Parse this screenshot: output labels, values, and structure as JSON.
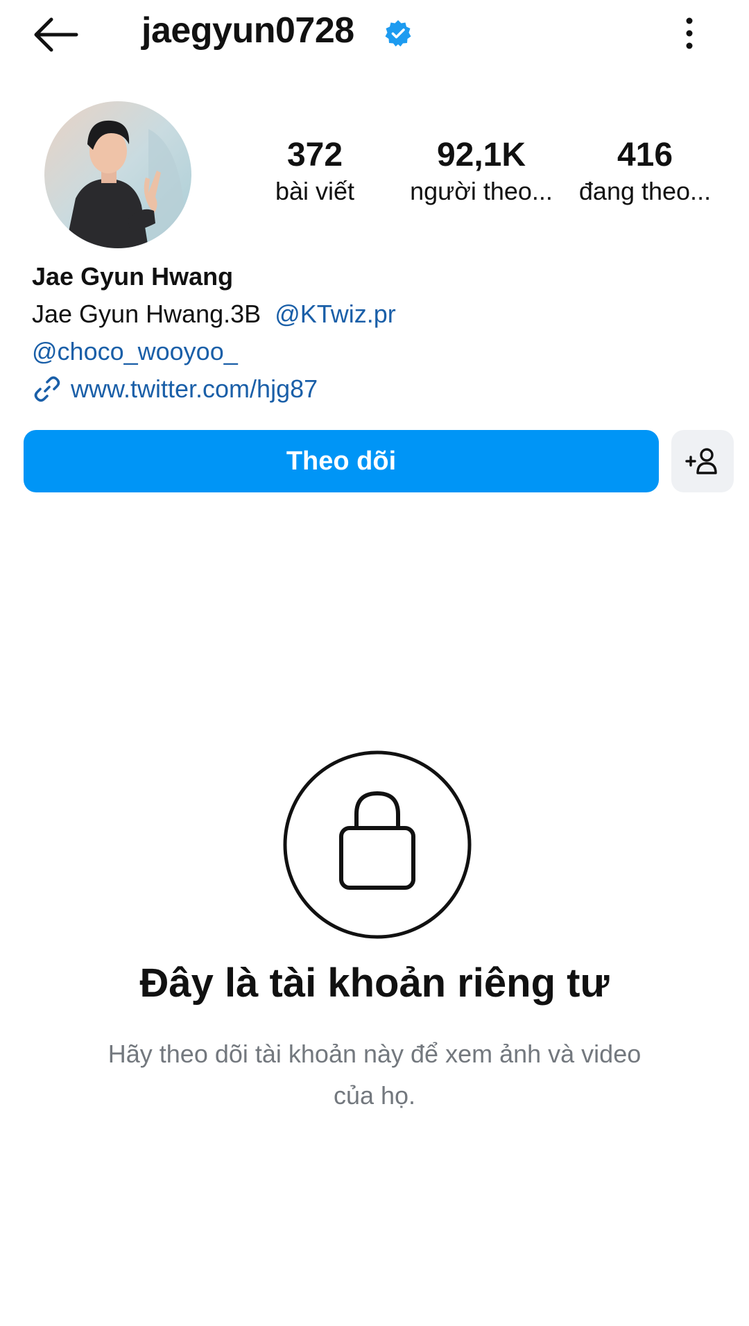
{
  "header": {
    "username": "jaegyun0728",
    "back_icon": "arrow-left-icon",
    "verified_icon": "verified-badge-icon",
    "more_icon": "more-vertical-icon"
  },
  "stats": [
    {
      "value": "372",
      "label": "bài viết"
    },
    {
      "value": "92,1K",
      "label": "người theo..."
    },
    {
      "value": "416",
      "label": "đang theo..."
    }
  ],
  "bio": {
    "display_name": "Jae Gyun Hwang",
    "line1_text": "Jae Gyun Hwang.3B",
    "line1_mention": "@KTwiz.pr",
    "line2_mention": "@choco_wooyoo_",
    "website": "www.twitter.com/hjg87"
  },
  "actions": {
    "follow_label": "Theo dõi",
    "add_user_icon": "add-user-icon"
  },
  "private": {
    "title": "Đây là tài khoản riêng tư",
    "description": "Hãy theo dõi tài khoản này để xem ảnh và video của họ."
  },
  "colors": {
    "accent": "#0095f6",
    "link": "#1a5fa8",
    "verified": "#1d9bf0",
    "muted_text": "#73787e",
    "secondary_button": "#eff1f4"
  }
}
